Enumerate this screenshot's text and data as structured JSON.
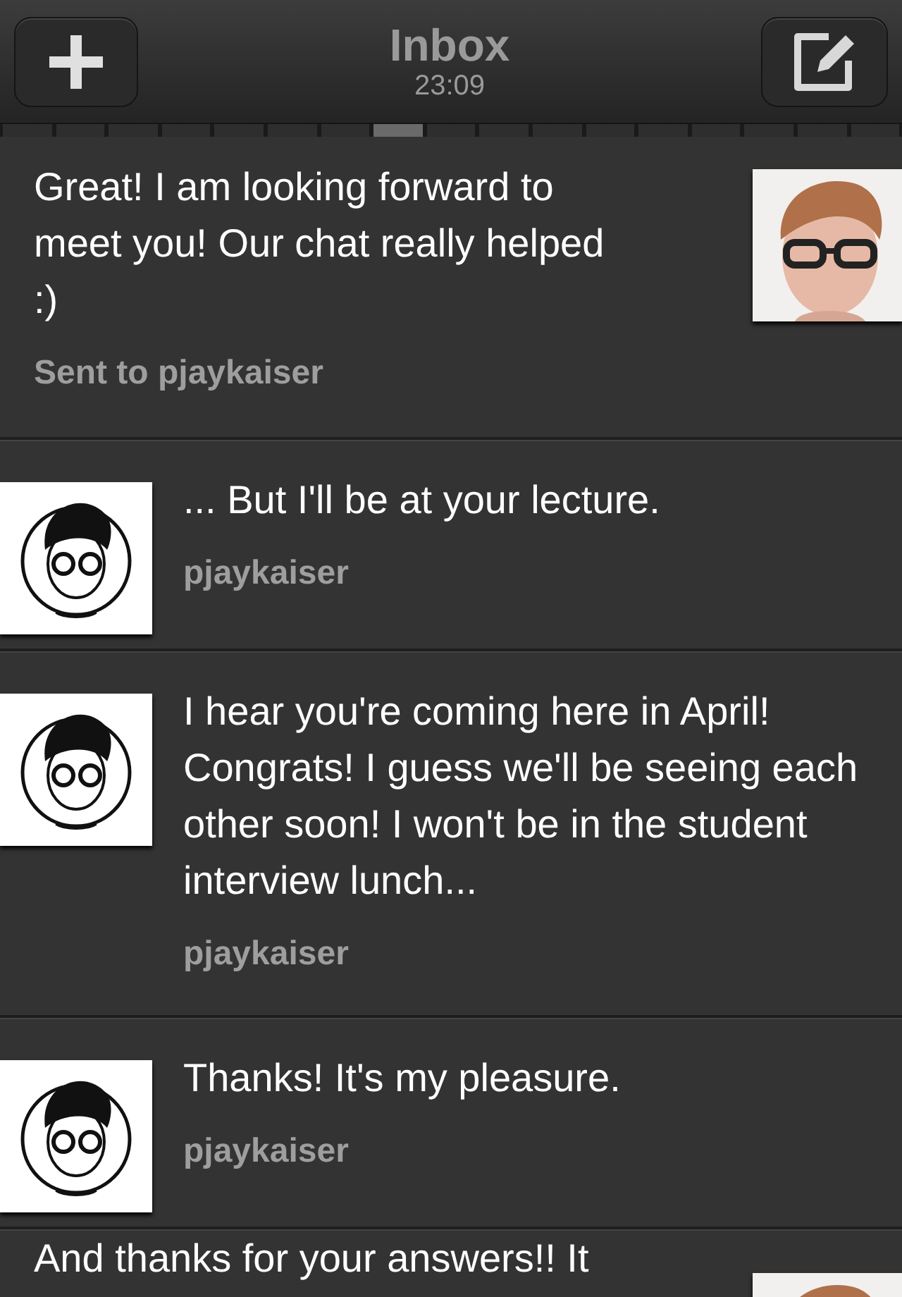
{
  "header": {
    "title": "Inbox",
    "time": "23:09"
  },
  "pager": [
    {
      "selected": false
    },
    {
      "selected": false
    },
    {
      "selected": false
    },
    {
      "selected": false
    },
    {
      "selected": false
    },
    {
      "selected": false
    },
    {
      "selected": false
    },
    {
      "selected": true
    },
    {
      "selected": false
    },
    {
      "selected": false
    },
    {
      "selected": false
    },
    {
      "selected": false
    },
    {
      "selected": false
    },
    {
      "selected": false
    },
    {
      "selected": false
    },
    {
      "selected": false
    },
    {
      "selected": false
    }
  ],
  "messages": [
    {
      "kind": "sent",
      "text": "Great! I am looking forward to meet you! Our chat really helped :)",
      "meta": "Sent to pjaykaiser"
    },
    {
      "kind": "received",
      "text": "... But I'll be at your lecture.",
      "meta": "pjaykaiser"
    },
    {
      "kind": "received",
      "text": "I hear you're coming here in April! Congrats! I guess we'll be seeing each other soon! I won't be in the student interview lunch...",
      "meta": "pjaykaiser"
    },
    {
      "kind": "received",
      "text": "Thanks! It's my pleasure.",
      "meta": "pjaykaiser"
    },
    {
      "kind": "sent",
      "text": "And thanks for your answers!! It"
    }
  ]
}
